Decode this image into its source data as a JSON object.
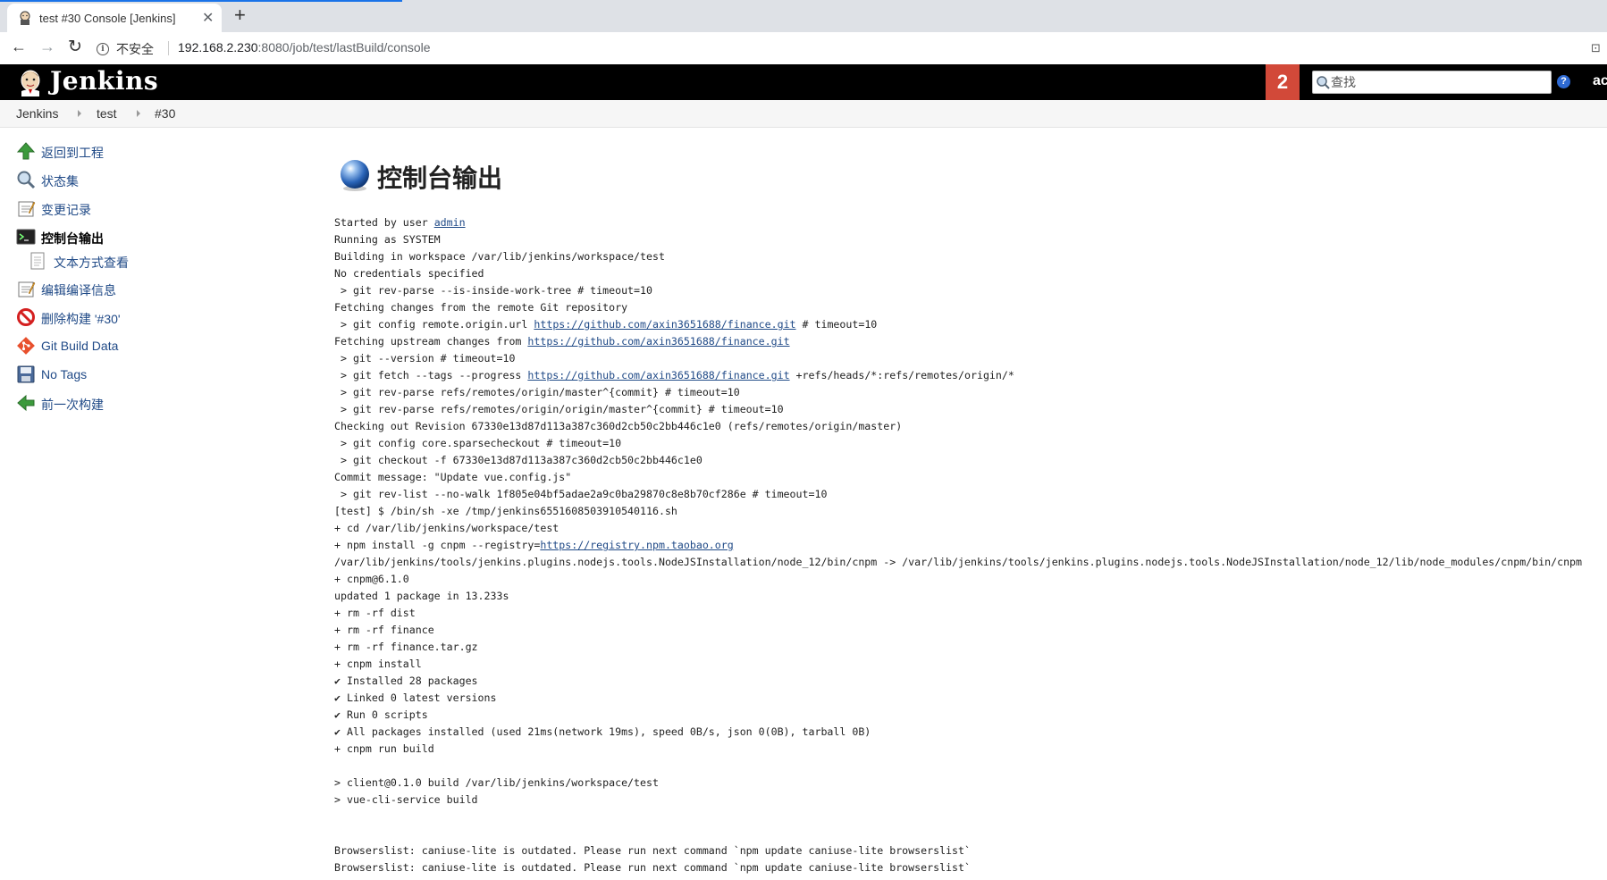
{
  "browser": {
    "tab_title": "test #30 Console [Jenkins]",
    "tab_close": "✕",
    "new_tab": "+",
    "security_label": "不安全",
    "url_host": "192.168.2.230",
    "url_rest": ":8080/job/test/lastBuild/console",
    "translate_glyph": "⊡"
  },
  "header": {
    "logo_text": "Jenkins",
    "notification_count": "2",
    "search_placeholder": "查找",
    "help_glyph": "?",
    "user_label": "ac"
  },
  "breadcrumb": [
    "Jenkins",
    "test",
    "#30"
  ],
  "sidebar": {
    "items": [
      {
        "label": "返回到工程",
        "icon": "up-arrow-icon"
      },
      {
        "label": "状态集",
        "icon": "magnifier-icon"
      },
      {
        "label": "变更记录",
        "icon": "notepad-icon"
      },
      {
        "label": "控制台输出",
        "icon": "terminal-icon",
        "active": true
      },
      {
        "label": "文本方式查看",
        "icon": "document-icon"
      },
      {
        "label": "编辑编译信息",
        "icon": "notepad-icon"
      },
      {
        "label": "删除构建 '#30'",
        "icon": "no-entry-icon"
      },
      {
        "label": "Git Build Data",
        "icon": "git-icon"
      },
      {
        "label": "No Tags",
        "icon": "floppy-icon"
      },
      {
        "label": "前一次构建",
        "icon": "left-arrow-icon"
      }
    ]
  },
  "main": {
    "title": "控制台输出",
    "console_lines": [
      [
        {
          "t": "Started by user "
        },
        {
          "t": "admin",
          "link": true
        }
      ],
      [
        {
          "t": "Running as SYSTEM"
        }
      ],
      [
        {
          "t": "Building in workspace /var/lib/jenkins/workspace/test"
        }
      ],
      [
        {
          "t": "No credentials specified"
        }
      ],
      [
        {
          "t": " > git rev-parse --is-inside-work-tree # timeout=10"
        }
      ],
      [
        {
          "t": "Fetching changes from the remote Git repository"
        }
      ],
      [
        {
          "t": " > git config remote.origin.url "
        },
        {
          "t": "https://github.com/axin3651688/finance.git",
          "link": true
        },
        {
          "t": " # timeout=10"
        }
      ],
      [
        {
          "t": "Fetching upstream changes from "
        },
        {
          "t": "https://github.com/axin3651688/finance.git",
          "link": true
        }
      ],
      [
        {
          "t": " > git --version # timeout=10"
        }
      ],
      [
        {
          "t": " > git fetch --tags --progress "
        },
        {
          "t": "https://github.com/axin3651688/finance.git",
          "link": true
        },
        {
          "t": " +refs/heads/*:refs/remotes/origin/*"
        }
      ],
      [
        {
          "t": " > git rev-parse refs/remotes/origin/master^{commit} # timeout=10"
        }
      ],
      [
        {
          "t": " > git rev-parse refs/remotes/origin/origin/master^{commit} # timeout=10"
        }
      ],
      [
        {
          "t": "Checking out Revision 67330e13d87d113a387c360d2cb50c2bb446c1e0 (refs/remotes/origin/master)"
        }
      ],
      [
        {
          "t": " > git config core.sparsecheckout # timeout=10"
        }
      ],
      [
        {
          "t": " > git checkout -f 67330e13d87d113a387c360d2cb50c2bb446c1e0"
        }
      ],
      [
        {
          "t": "Commit message: \"Update vue.config.js\""
        }
      ],
      [
        {
          "t": " > git rev-list --no-walk 1f805e04bf5adae2a9c0ba29870c8e8b70cf286e # timeout=10"
        }
      ],
      [
        {
          "t": "[test] $ /bin/sh -xe /tmp/jenkins6551608503910540116.sh"
        }
      ],
      [
        {
          "t": "+ cd /var/lib/jenkins/workspace/test"
        }
      ],
      [
        {
          "t": "+ npm install -g cnpm --registry="
        },
        {
          "t": "https://registry.npm.taobao.org",
          "link": true
        }
      ],
      [
        {
          "t": "/var/lib/jenkins/tools/jenkins.plugins.nodejs.tools.NodeJSInstallation/node_12/bin/cnpm -> /var/lib/jenkins/tools/jenkins.plugins.nodejs.tools.NodeJSInstallation/node_12/lib/node_modules/cnpm/bin/cnpm"
        }
      ],
      [
        {
          "t": "+ cnpm@6.1.0"
        }
      ],
      [
        {
          "t": "updated 1 package in 13.233s"
        }
      ],
      [
        {
          "t": "+ rm -rf dist"
        }
      ],
      [
        {
          "t": "+ rm -rf finance"
        }
      ],
      [
        {
          "t": "+ rm -rf finance.tar.gz"
        }
      ],
      [
        {
          "t": "+ cnpm install"
        }
      ],
      [
        {
          "t": "✔ Installed 28 packages"
        }
      ],
      [
        {
          "t": "✔ Linked 0 latest versions"
        }
      ],
      [
        {
          "t": "✔ Run 0 scripts"
        }
      ],
      [
        {
          "t": "✔ All packages installed (used 21ms(network 19ms), speed 0B/s, json 0(0B), tarball 0B)"
        }
      ],
      [
        {
          "t": "+ cnpm run build"
        }
      ],
      [
        {
          "t": ""
        }
      ],
      [
        {
          "t": "> client@0.1.0 build /var/lib/jenkins/workspace/test"
        }
      ],
      [
        {
          "t": "> vue-cli-service build"
        }
      ],
      [
        {
          "t": ""
        }
      ],
      [
        {
          "t": ""
        }
      ],
      [
        {
          "t": "Browserslist: caniuse-lite is outdated. Please run next command `npm update caniuse-lite browserslist`"
        }
      ],
      [
        {
          "t": "Browserslist: caniuse-lite is outdated. Please run next command `npm update caniuse-lite browserslist`"
        }
      ]
    ]
  }
}
